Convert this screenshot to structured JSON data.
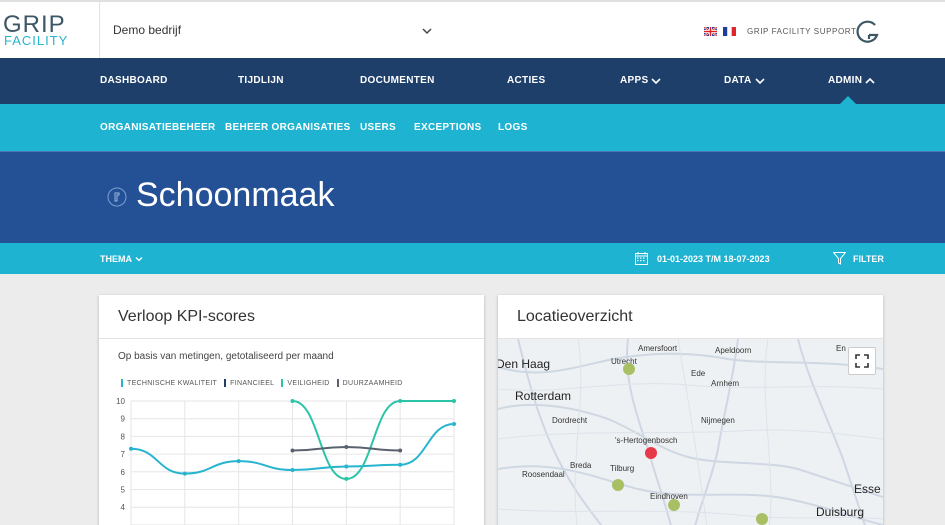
{
  "header": {
    "logo_line1": "GRIP",
    "logo_line2": "FACILITY",
    "company": "Demo bedrijf",
    "support": "GRIP FACILITY SUPPORT"
  },
  "nav": {
    "items": [
      {
        "label": "DASHBOARD"
      },
      {
        "label": "TIJDLIJN"
      },
      {
        "label": "DOCUMENTEN"
      },
      {
        "label": "ACTIES"
      },
      {
        "label": "APPS"
      },
      {
        "label": "DATA"
      },
      {
        "label": "ADMIN"
      }
    ]
  },
  "subnav": {
    "items": [
      {
        "label": "ORGANISATIEBEHEER"
      },
      {
        "label": "BEHEER ORGANISATIES"
      },
      {
        "label": "USERS"
      },
      {
        "label": "EXCEPTIONS"
      },
      {
        "label": "LOGS"
      }
    ]
  },
  "hero": {
    "title": "Schoonmaak"
  },
  "filterbar": {
    "thema": "THEMA",
    "date_range": "01-01-2023 T/M 18-07-2023",
    "filter": "FILTER"
  },
  "kpi_card": {
    "title": "Verloop KPI-scores",
    "subtitle": "Op basis van metingen, getotaliseerd per maand"
  },
  "map_card": {
    "title": "Locatieoverzicht",
    "labels": [
      "Den Haag",
      "Utrecht",
      "Amersfoort",
      "Apeldoorn",
      "En",
      "Ede",
      "Arnhem",
      "Rotterdam",
      "Dordrecht",
      "Nijmegen",
      "'s-Hertogenbosch",
      "Breda",
      "Tilburg",
      "Roosendaal",
      "Eindhoven",
      "Esse",
      "Duisburg"
    ]
  },
  "colors": {
    "primary_nav": "#1e3f6a",
    "accent": "#1fb3d2",
    "hero": "#245196",
    "marker_green": "#a9bf63",
    "marker_red": "#e8394a"
  },
  "chart_data": {
    "type": "line",
    "title": "Verloop KPI-scores",
    "yticks": [
      "10",
      "9",
      "8",
      "7",
      "6",
      "5",
      "4"
    ],
    "ylim": [
      4,
      10
    ],
    "x": [
      1,
      2,
      3,
      4,
      5,
      6,
      7
    ],
    "series": [
      {
        "name": "TECHNISCHE KWALITEIT",
        "color": "#27b4cf",
        "values": [
          7.3,
          5.9,
          6.6,
          6.1,
          6.3,
          6.4,
          8.7
        ]
      },
      {
        "name": "FINANCIEEL",
        "color": "#1e3f6a",
        "values": [
          null,
          null,
          null,
          null,
          null,
          null,
          null
        ]
      },
      {
        "name": "VEILIGHEID",
        "color": "#2bc4a8",
        "values": [
          null,
          null,
          null,
          10,
          5.6,
          10,
          10
        ]
      },
      {
        "name": "DUURZAAMHEID",
        "color": "#5a6270",
        "values": [
          null,
          null,
          null,
          7.2,
          7.4,
          7.2,
          null
        ]
      }
    ]
  }
}
